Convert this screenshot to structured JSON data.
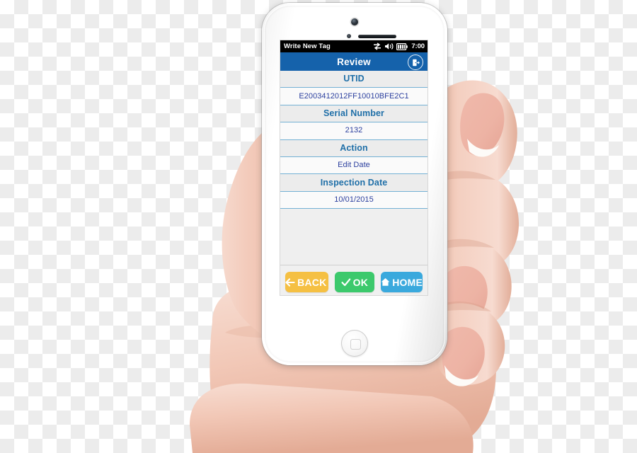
{
  "device": {
    "name": "white-smartphone",
    "held_by": "hand"
  },
  "status_bar": {
    "app_title": "Write New Tag",
    "icons": [
      "data-transfer-icon",
      "speaker-mute-icon",
      "battery-icon"
    ],
    "time": "7:00"
  },
  "title_bar": {
    "title": "Review",
    "right_icon": "logout-icon",
    "background_color": "#1562ab"
  },
  "fields": [
    {
      "label": "UTID",
      "value": "E2003412012FF10010BFE2C1"
    },
    {
      "label": "Serial Number",
      "value": "2132"
    },
    {
      "label": "Action",
      "value": "Edit Date"
    },
    {
      "label": "Inspection Date",
      "value": "10/01/2015"
    }
  ],
  "buttons": [
    {
      "label": "BACK",
      "icon": "arrow-left-icon",
      "color": "#f5c043"
    },
    {
      "label": "OK",
      "icon": "check-icon",
      "color": "#3cc96c"
    },
    {
      "label": "HOME",
      "icon": "house-icon",
      "color": "#3aa9dd"
    }
  ],
  "colors": {
    "header_blue": "#1562ab",
    "label_blue": "#1f6fa8",
    "value_navy": "#2b3f9e",
    "divider_blue": "#73b0d4"
  }
}
